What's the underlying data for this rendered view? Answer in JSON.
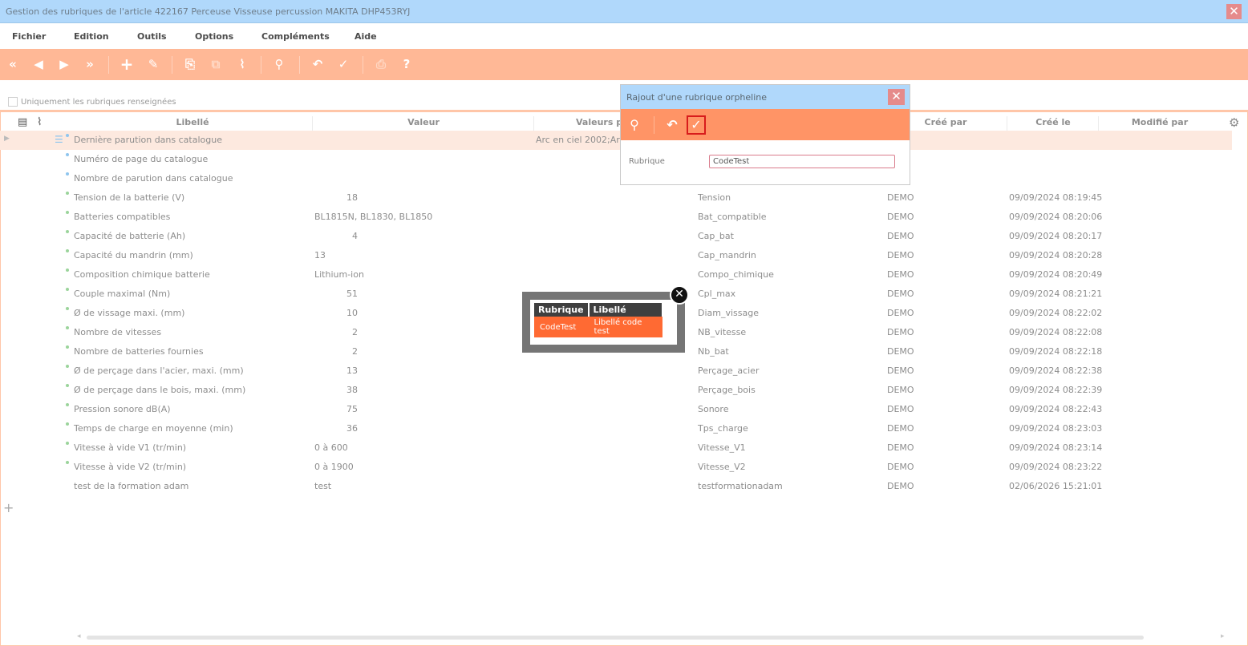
{
  "window": {
    "title": "Gestion des rubriques de l'article 422167 Perceuse Visseuse percussion MAKITA DHP453RYJ",
    "close": "✕"
  },
  "menu": [
    "Fichier",
    "Edition",
    "Outils",
    "Options",
    "Compléments",
    "Aide"
  ],
  "toolbar": {
    "first": "«",
    "prev": "◀",
    "next": "▶",
    "last": "»",
    "add": "+",
    "edit": "✎",
    "paste": "⎘",
    "copy": "⧉",
    "attach": "⌇",
    "zoom": "⚲",
    "undo": "↶",
    "validate": "✓",
    "print": "⎙",
    "help": "?"
  },
  "filter": {
    "label": "Uniquement les rubriques renseignées",
    "checked": false
  },
  "grid": {
    "headers": {
      "libelle": "Libellé",
      "valeur": "Valeur",
      "valeurs_possibles": "Valeurs po",
      "cree_par": "Créé par",
      "cree_le": "Créé le",
      "modifie_par": "Modifié par"
    },
    "rows": [
      {
        "label": "Dernière parution dans catalogue",
        "value": "",
        "possibles": "Arc en ciel 2002;Arc e",
        "code": "",
        "user": "",
        "date": "",
        "dot": "blue",
        "selected": true
      },
      {
        "label": "Numéro de page du catalogue",
        "value": "",
        "possibles": "",
        "code": "",
        "user": "",
        "date": "",
        "dot": "blue"
      },
      {
        "label": "Nombre de parution dans catalogue",
        "value": "",
        "possibles": "",
        "code": "",
        "user": "",
        "date": "",
        "dot": "blue"
      },
      {
        "label": "Tension de la batterie (V)",
        "value": "18",
        "possibles": "",
        "code": "Tension",
        "user": "DEMO",
        "date": "09/09/2024 08:19:45",
        "dot": "green",
        "num": true
      },
      {
        "label": "Batteries compatibles",
        "value": "BL1815N, BL1830, BL1850",
        "possibles": "",
        "code": "Bat_compatible",
        "user": "DEMO",
        "date": "09/09/2024 08:20:06",
        "dot": "green"
      },
      {
        "label": "Capacité de batterie (Ah)",
        "value": "4",
        "possibles": "",
        "code": "Cap_bat",
        "user": "DEMO",
        "date": "09/09/2024 08:20:17",
        "dot": "green",
        "num": true
      },
      {
        "label": "Capacité du mandrin (mm)",
        "value": "13",
        "possibles": "",
        "code": "Cap_mandrin",
        "user": "DEMO",
        "date": "09/09/2024 08:20:28",
        "dot": "green"
      },
      {
        "label": "Composition chimique batterie",
        "value": "Lithium-ion",
        "possibles": "",
        "code": "Compo_chimique",
        "user": "DEMO",
        "date": "09/09/2024 08:20:49",
        "dot": "green"
      },
      {
        "label": "Couple maximal (Nm)",
        "value": "51",
        "possibles": "",
        "code": "Cpl_max",
        "user": "DEMO",
        "date": "09/09/2024 08:21:21",
        "dot": "green",
        "num": true
      },
      {
        "label": "Ø de vissage maxi. (mm)",
        "value": "10",
        "possibles": "",
        "code": "Diam_vissage",
        "user": "DEMO",
        "date": "09/09/2024 08:22:02",
        "dot": "green",
        "num": true
      },
      {
        "label": "Nombre de vitesses",
        "value": "2",
        "possibles": "",
        "code": "NB_vitesse",
        "user": "DEMO",
        "date": "09/09/2024 08:22:08",
        "dot": "green",
        "num": true
      },
      {
        "label": "Nombre de batteries fournies",
        "value": "2",
        "possibles": "",
        "code": "Nb_bat",
        "user": "DEMO",
        "date": "09/09/2024 08:22:18",
        "dot": "green",
        "num": true
      },
      {
        "label": "Ø de perçage dans l'acier, maxi. (mm)",
        "value": "13",
        "possibles": "",
        "code": "Perçage_acier",
        "user": "DEMO",
        "date": "09/09/2024 08:22:38",
        "dot": "green",
        "num": true
      },
      {
        "label": "Ø de perçage dans le bois, maxi. (mm)",
        "value": "38",
        "possibles": "",
        "code": "Perçage_bois",
        "user": "DEMO",
        "date": "09/09/2024 08:22:39",
        "dot": "green",
        "num": true
      },
      {
        "label": "Pression sonore dB(A)",
        "value": "75",
        "possibles": "",
        "code": "Sonore",
        "user": "DEMO",
        "date": "09/09/2024 08:22:43",
        "dot": "green",
        "num": true
      },
      {
        "label": "Temps de charge en moyenne (min)",
        "value": "36",
        "possibles": "",
        "code": "Tps_charge",
        "user": "DEMO",
        "date": "09/09/2024 08:23:03",
        "dot": "green",
        "num": true
      },
      {
        "label": "Vitesse à vide V1 (tr/min)",
        "value": "0 à 600",
        "possibles": "",
        "code": "Vitesse_V1",
        "user": "DEMO",
        "date": "09/09/2024 08:23:14",
        "dot": "green"
      },
      {
        "label": "Vitesse à vide V2 (tr/min)",
        "value": "0 à 1900",
        "possibles": "",
        "code": "Vitesse_V2",
        "user": "DEMO",
        "date": "09/09/2024 08:23:22",
        "dot": "green"
      },
      {
        "label": "test de la formation adam",
        "value": "test",
        "possibles": "",
        "code": "testformationadam",
        "user": "DEMO",
        "date": "02/06/2026 15:21:01",
        "dot": ""
      }
    ]
  },
  "dialog": {
    "title": "Rajout d'une rubrique orpheline",
    "close": "✕",
    "field_label": "Rubrique",
    "field_value": "CodeTest",
    "search": "⚲",
    "undo": "↶",
    "validate": "✓"
  },
  "popup": {
    "headers": [
      "Rubrique",
      "Libellé"
    ],
    "row": [
      "CodeTest",
      "Libellé code test"
    ],
    "close": "✕"
  },
  "colors": {
    "toolbar": "#ffb896",
    "dialog_toolbar": "#ff9466",
    "title": "#b0d8fb",
    "highlight": "#ff6a33"
  }
}
